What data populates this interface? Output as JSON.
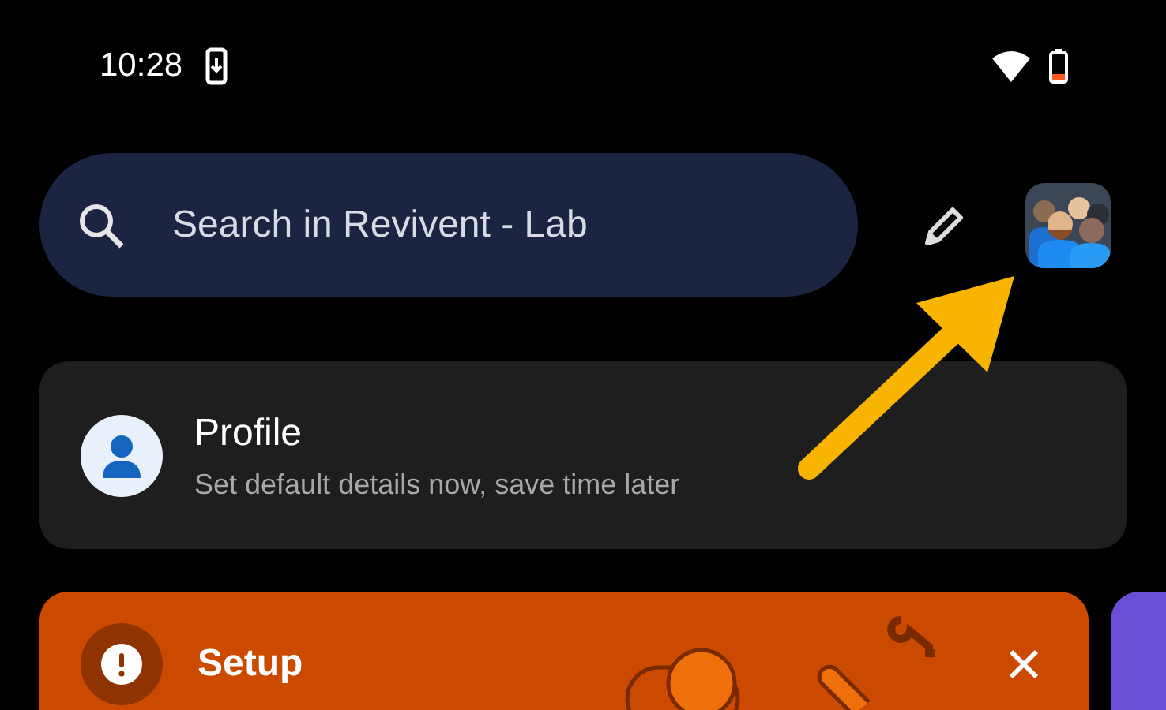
{
  "status_bar": {
    "time": "10:28"
  },
  "search": {
    "placeholder": "Search in Revivent - Lab"
  },
  "profile_card": {
    "title": "Profile",
    "subtitle": "Set default details now, save time later"
  },
  "setup_card": {
    "title": "Setup"
  }
}
